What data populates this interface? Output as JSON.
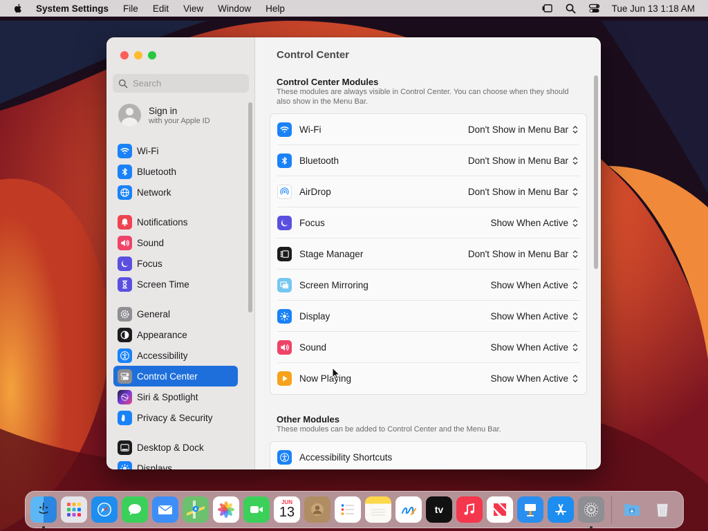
{
  "menubar": {
    "app_name": "System Settings",
    "items": [
      "File",
      "Edit",
      "View",
      "Window",
      "Help"
    ],
    "clock": "Tue Jun 13  1:18 AM"
  },
  "sidebar": {
    "search_placeholder": "Search",
    "profile": {
      "name": "Sign in",
      "subtitle": "with your Apple ID"
    },
    "items": [
      {
        "label": "Wi-Fi",
        "icon": "wifi-icon",
        "color": "#1a82f7"
      },
      {
        "label": "Bluetooth",
        "icon": "bluetooth-icon",
        "color": "#1a82f7"
      },
      {
        "label": "Network",
        "icon": "globe-icon",
        "color": "#1a82f7"
      },
      {
        "label": "Notifications",
        "icon": "bell-icon",
        "color": "#ef4350"
      },
      {
        "label": "Sound",
        "icon": "speaker-icon",
        "color": "#ef4368"
      },
      {
        "label": "Focus",
        "icon": "moon-icon",
        "color": "#5b4fe0"
      },
      {
        "label": "Screen Time",
        "icon": "hourglass-icon",
        "color": "#5b4fe0"
      },
      {
        "label": "General",
        "icon": "gear-icon",
        "color": "#8e8e93"
      },
      {
        "label": "Appearance",
        "icon": "appearance-icon",
        "color": "#1c1c1e"
      },
      {
        "label": "Accessibility",
        "icon": "accessibility-icon",
        "color": "#1a82f7"
      },
      {
        "label": "Control Center",
        "icon": "toggles-icon",
        "color": "#8e8e93"
      },
      {
        "label": "Siri & Spotlight",
        "icon": "siri-icon",
        "color": "#7a3bd6"
      },
      {
        "label": "Privacy & Security",
        "icon": "hand-icon",
        "color": "#1a82f7"
      },
      {
        "label": "Desktop & Dock",
        "icon": "dock-icon",
        "color": "#1c1c1e"
      },
      {
        "label": "Displays",
        "icon": "sun-icon",
        "color": "#1a82f7"
      }
    ]
  },
  "main": {
    "title": "Control Center",
    "section1": {
      "title": "Control Center Modules",
      "desc": "These modules are always visible in Control Center. You can choose when they should also show in the Menu Bar.",
      "rows": [
        {
          "label": "Wi-Fi",
          "value": "Don't Show in Menu Bar",
          "icon": "wifi-icon",
          "color": "#1a82f7"
        },
        {
          "label": "Bluetooth",
          "value": "Don't Show in Menu Bar",
          "icon": "bluetooth-icon",
          "color": "#1a82f7"
        },
        {
          "label": "AirDrop",
          "value": "Don't Show in Menu Bar",
          "icon": "airdrop-icon",
          "color": "#ffffff"
        },
        {
          "label": "Focus",
          "value": "Show When Active",
          "icon": "moon-icon",
          "color": "#5b4fe0"
        },
        {
          "label": "Stage Manager",
          "value": "Don't Show in Menu Bar",
          "icon": "stage-manager-icon",
          "color": "#1c1c1e"
        },
        {
          "label": "Screen Mirroring",
          "value": "Show When Active",
          "icon": "screen-mirroring-icon",
          "color": "#74c7f0"
        },
        {
          "label": "Display",
          "value": "Show When Active",
          "icon": "sun-icon",
          "color": "#1a82f7"
        },
        {
          "label": "Sound",
          "value": "Show When Active",
          "icon": "speaker-icon",
          "color": "#ef4368"
        },
        {
          "label": "Now Playing",
          "value": "Show When Active",
          "icon": "play-icon",
          "color": "#f7a21a"
        }
      ]
    },
    "section2": {
      "title": "Other Modules",
      "desc": "These modules can be added to Control Center and the Menu Bar.",
      "rows": [
        {
          "label": "Accessibility Shortcuts",
          "icon": "accessibility-icon",
          "color": "#1a82f7"
        }
      ]
    }
  },
  "dock": {
    "apps": [
      {
        "name": "finder-icon",
        "color": "#4aa3f0",
        "running": true
      },
      {
        "name": "launchpad-icon",
        "color": "#e5e5ea",
        "running": false
      },
      {
        "name": "safari-icon",
        "color": "#1d8df0",
        "running": false
      },
      {
        "name": "messages-icon",
        "color": "#3bd05a",
        "running": false
      },
      {
        "name": "mail-icon",
        "color": "#3d8ef7",
        "running": false
      },
      {
        "name": "maps-icon",
        "color": "#6cc16f",
        "running": false
      },
      {
        "name": "photos-icon",
        "color": "#ffffff",
        "running": false
      },
      {
        "name": "facetime-icon",
        "color": "#3bd05a",
        "running": false
      },
      {
        "name": "calendar-icon",
        "color": "#ffffff",
        "running": false,
        "month": "JUN",
        "day": "13"
      },
      {
        "name": "contacts-icon",
        "color": "#b08d62",
        "running": false
      },
      {
        "name": "reminders-icon",
        "color": "#ffffff",
        "running": false
      },
      {
        "name": "notes-icon",
        "color": "#fcd84a",
        "running": false
      },
      {
        "name": "freeform-icon",
        "color": "#ffffff",
        "running": false
      },
      {
        "name": "apple-tv-icon",
        "color": "#111111",
        "running": false,
        "text": "tv"
      },
      {
        "name": "music-icon",
        "color": "#f5374d",
        "running": false
      },
      {
        "name": "news-icon",
        "color": "#ffffff",
        "running": false
      },
      {
        "name": "keynote-icon",
        "color": "#2a8ef0",
        "running": false
      },
      {
        "name": "app-store-icon",
        "color": "#1d8df0",
        "running": false
      },
      {
        "name": "system-settings-icon",
        "color": "#8e8e93",
        "running": true
      }
    ],
    "extras": [
      {
        "name": "downloads-folder-icon",
        "color": "#67b2ea"
      },
      {
        "name": "trash-icon",
        "color": "#e8e8ea"
      }
    ]
  }
}
